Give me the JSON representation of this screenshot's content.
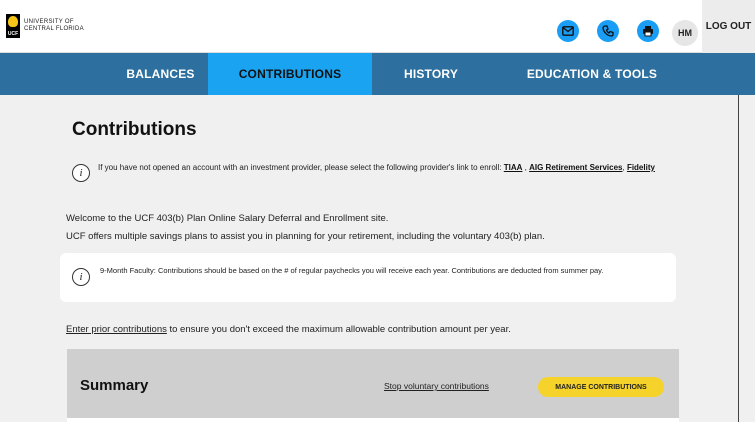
{
  "header": {
    "logo_mark": "UCF",
    "logo_line1": "UNIVERSITY OF",
    "logo_line2": "CENTRAL FLORIDA",
    "icons": [
      "mail-icon",
      "phone-icon",
      "printer-icon"
    ],
    "icon_color": "#1a9ef5",
    "avatar_initials": "HM",
    "logout_label": "LOG OUT"
  },
  "nav": {
    "tabs": [
      {
        "label": "BALANCES",
        "active": false
      },
      {
        "label": "CONTRIBUTIONS",
        "active": true
      },
      {
        "label": "HISTORY",
        "active": false
      },
      {
        "label": "EDUCATION & TOOLS",
        "active": false
      }
    ],
    "bar_color": "#2d6f9e",
    "active_color": "#1aa3f0"
  },
  "main": {
    "title": "Contributions",
    "info": {
      "icon_glyph": "i",
      "text": "If you have not opened an account with an investment provider, please select the following provider's link to enroll: ",
      "links": [
        "TIAA",
        "AIG Retirement Services",
        "Fidelity"
      ],
      "sep1": " , ",
      "sep2": ", "
    },
    "welcome_line1": "Welcome to the UCF 403(b) Plan Online Salary Deferral and Enrollment site.",
    "welcome_line2": "UCF offers multiple savings plans to assist you in planning for your retirement, including the voluntary 403(b) plan.",
    "notice_text": "9-Month Faculty: Contributions should be based on the # of regular paychecks you will receive each year. Contributions are deducted from summer pay.",
    "prior_link": "Enter prior contributions",
    "prior_text": " to ensure you don't exceed the maximum allowable contribution amount per year."
  },
  "summary": {
    "title": "Summary",
    "stop_link": "Stop voluntary contributions",
    "manage_button": "MANAGE CONTRIBUTIONS",
    "button_color": "#f5d32a"
  }
}
